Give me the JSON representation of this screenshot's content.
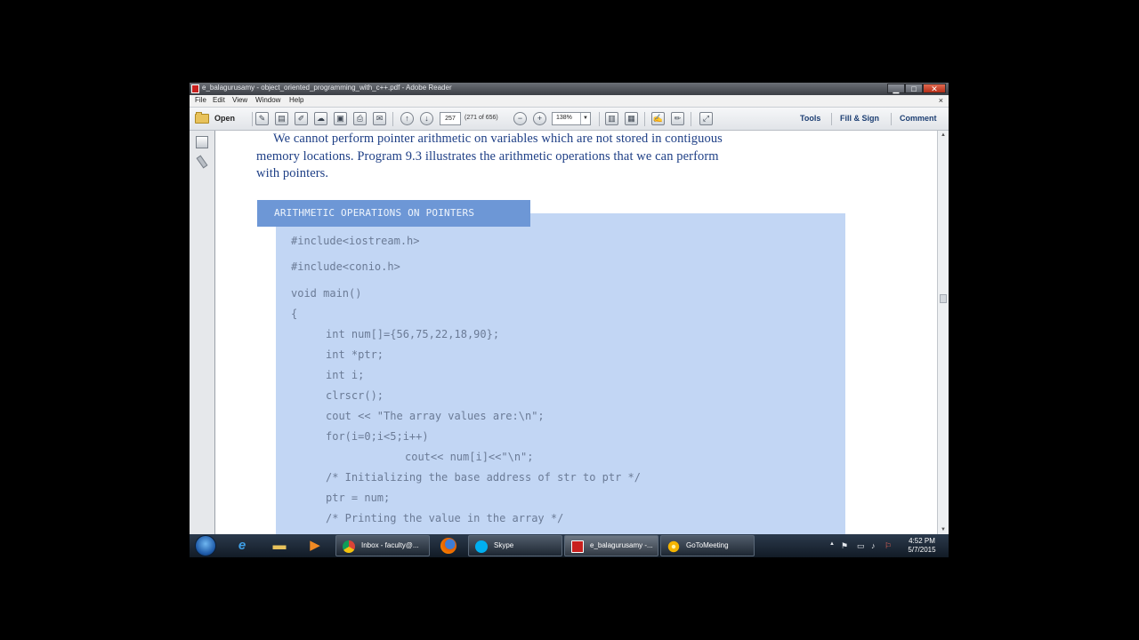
{
  "window": {
    "title": "e_balagurusamy - object_oriented_programming_with_c++.pdf - Adobe Reader",
    "min_glyph": "▁",
    "max_glyph": "□",
    "close_glyph": "✕"
  },
  "menu": {
    "items": [
      "File",
      "Edit",
      "View",
      "Window",
      "Help"
    ],
    "close_doc_glyph": "×"
  },
  "toolbar": {
    "open_label": "Open",
    "current_page": "257",
    "page_count": "(271 of 656)",
    "zoom": "138%",
    "tools_label": "Tools",
    "fill_sign_label": "Fill & Sign",
    "comment_label": "Comment"
  },
  "document": {
    "paragraph": [
      "We cannot perform pointer arithmetic on variables which are not stored in contiguous",
      "memory locations. Program 9.3 illustrates the arithmetic operations that we can perform",
      "with pointers."
    ],
    "code_title": "ARITHMETIC OPERATIONS ON POINTERS",
    "code_lines": [
      "#include<iostream.h>",
      "#include<conio.h>",
      "void main()",
      "{",
      "int num[]={56,75,22,18,90};",
      "int *ptr;",
      "int i;",
      "clrscr();",
      "cout << \"The array values are:\\n\";",
      "for(i=0;i<5;i++)",
      "cout<< num[i]<<\"\\n\";",
      "/* Initializing the base address of str to ptr */",
      "ptr = num;",
      "/* Printing the value in the array */"
    ]
  },
  "taskbar": {
    "tasks": [
      "Inbox - faculty@...",
      "Skype",
      "e_balagurusamy -...",
      "GoToMeeting"
    ],
    "time": "4:52 PM",
    "date": "5/7/2015"
  },
  "colors": {
    "body_text": "#1e3f86",
    "code_panel": "#c2d6f4",
    "code_header": "#6d97d6",
    "code_text": "#6b7b96",
    "link_text": "#1d3f73"
  }
}
